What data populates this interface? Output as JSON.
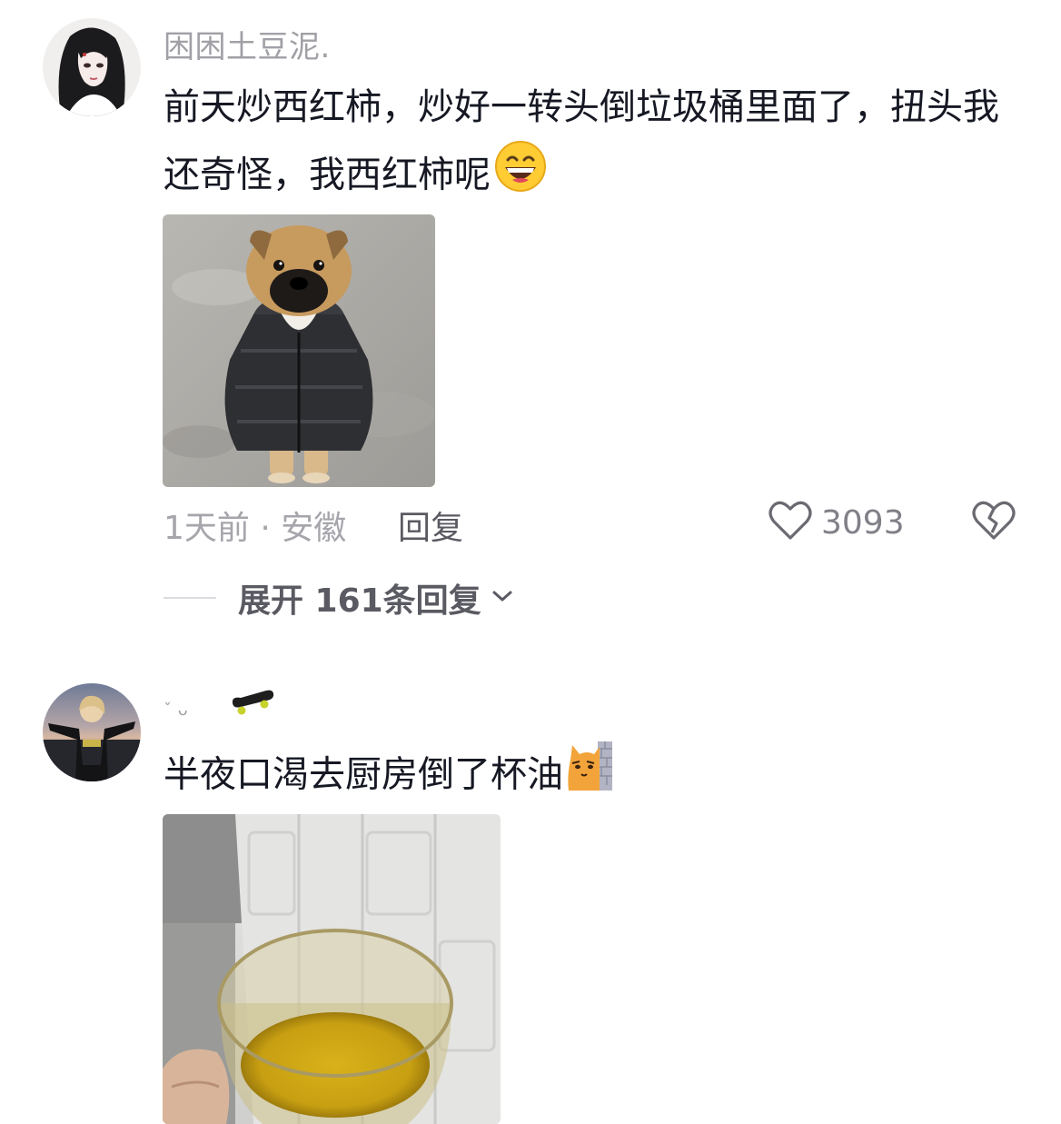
{
  "comments": [
    {
      "username": "困困土豆泥.",
      "text": "前天炒西红柿，炒好一转头倒垃圾桶里面了，扭头我还奇怪，我西红柿呢",
      "emoji": "grinning-face-emoji",
      "image": "puppy-in-black-puffer-jacket",
      "time_location": "1天前 · 安徽",
      "reply_label": "回复",
      "like_count": "3093",
      "expand_label": "展开 161条回复",
      "icons": [
        "heart-icon",
        "broken-heart-icon",
        "chevron-down-icon"
      ]
    },
    {
      "username_prefix": "ˇ ᴗ",
      "username_emoji": "skateboard-emoji",
      "text": "半夜口渴去厨房倒了杯油",
      "emoji": "cat-peeking-from-wall-emoji",
      "image": "glass-cup-of-cooking-oil"
    }
  ]
}
